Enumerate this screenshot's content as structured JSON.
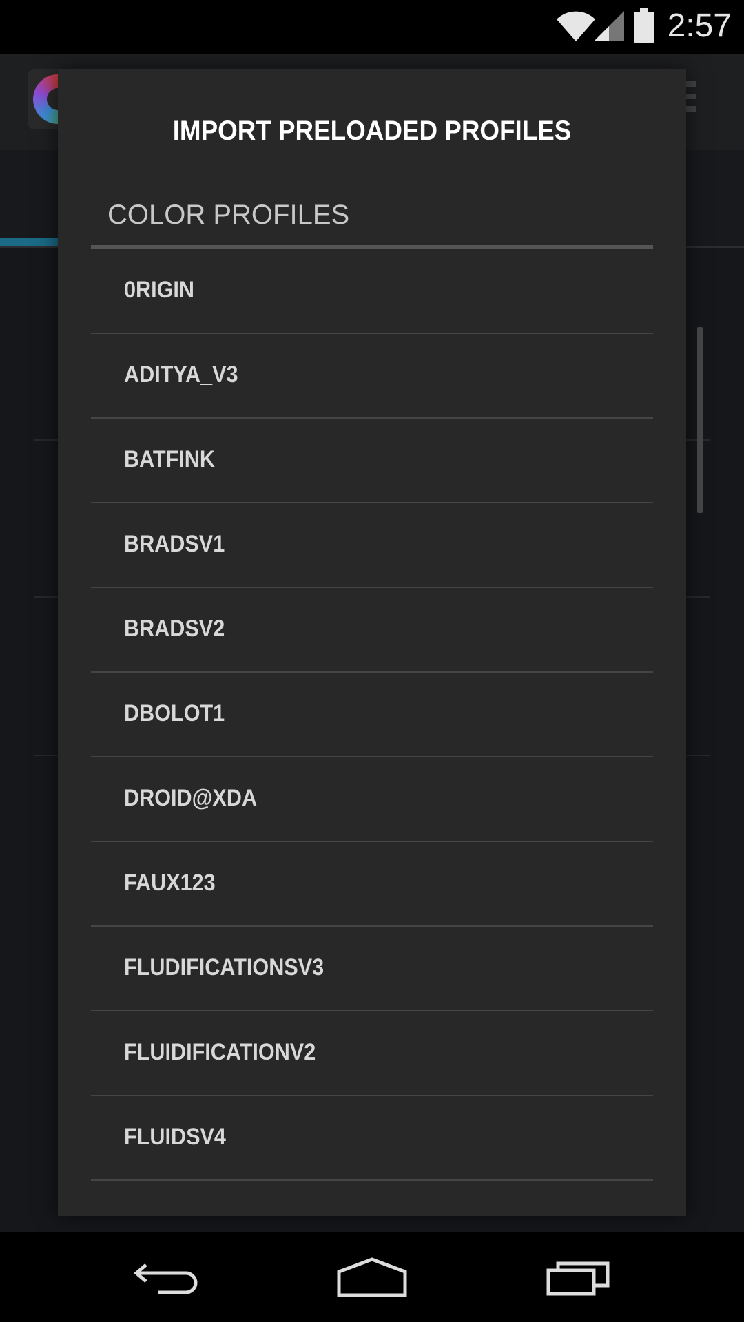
{
  "status_bar": {
    "time": "2:57",
    "icons": [
      "wifi-icon",
      "signal-icon",
      "battery-icon"
    ]
  },
  "dialog": {
    "title": "IMPORT PRELOADED PROFILES",
    "section_header": "COLOR PROFILES",
    "items": [
      {
        "label": "0RIGIN"
      },
      {
        "label": "ADITYA_V3"
      },
      {
        "label": "BATFINK"
      },
      {
        "label": "BRADSV1"
      },
      {
        "label": "BRADSV2"
      },
      {
        "label": "DBOLOT1"
      },
      {
        "label": "DROID@XDA"
      },
      {
        "label": "FAUX123"
      },
      {
        "label": "FLUDIFICATIONSV3"
      },
      {
        "label": "FLUIDIFICATIONV2"
      },
      {
        "label": "FLUIDSV4"
      }
    ]
  },
  "nav_bar": {
    "buttons": [
      "back-icon",
      "home-icon",
      "recents-icon"
    ]
  },
  "colors": {
    "dialog_bg": "#282828",
    "accent": "#1b6a86",
    "text_primary": "#ffffff",
    "text_item": "#d8d8d8"
  }
}
